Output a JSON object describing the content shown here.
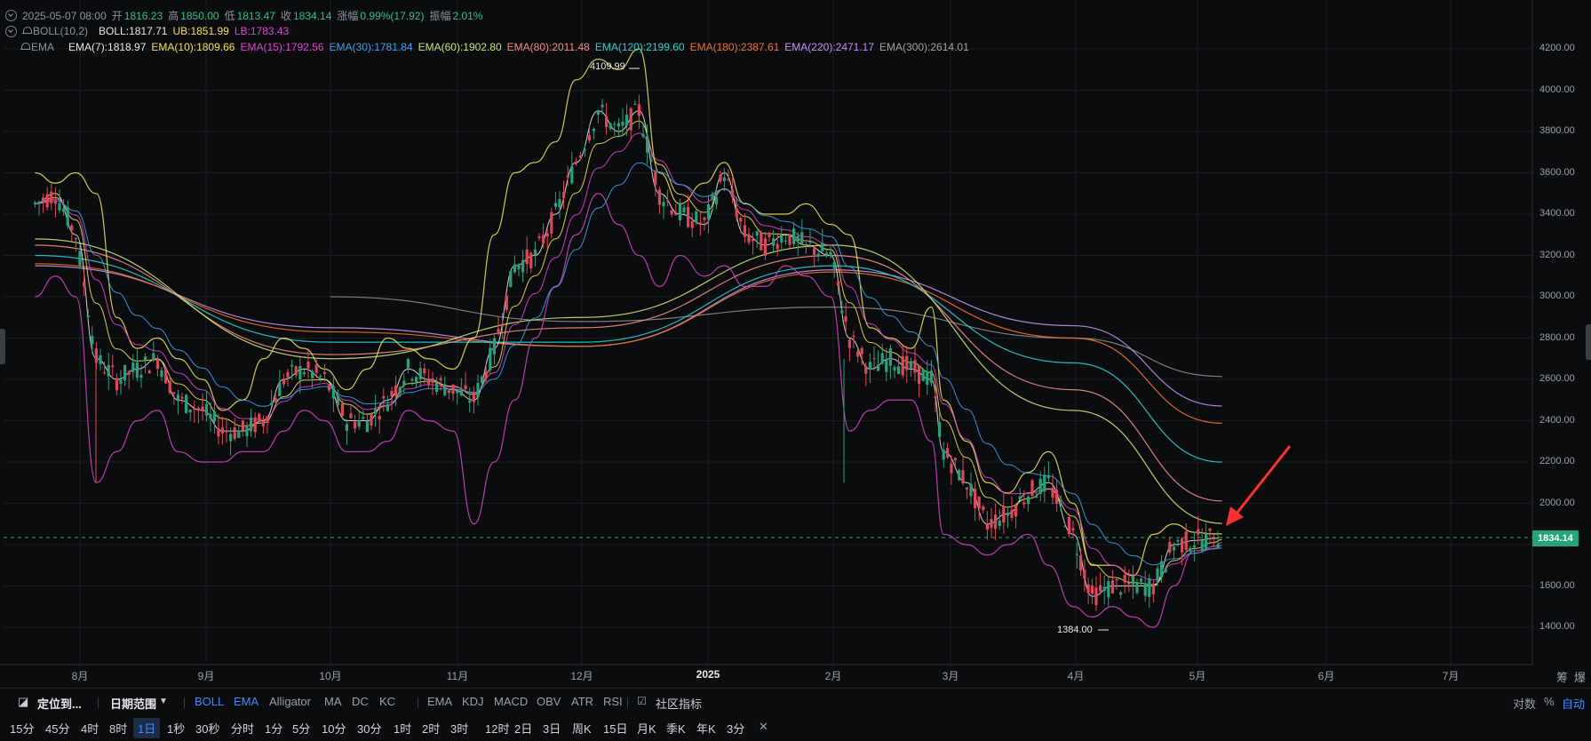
{
  "header": {
    "line1": {
      "date": "2025-05-07 08:00",
      "open_label": "开",
      "open": "1816.23",
      "high_label": "高",
      "high": "1850.00",
      "low_label": "低",
      "low": "1813.47",
      "close_label": "收",
      "close": "1834.14",
      "change_label": "涨幅",
      "change": "0.99%(17.92)",
      "amp_label": "振幅",
      "amp": "2.01%"
    },
    "line2": {
      "indicator": "BOLL(10,2)",
      "boll": "BOLL:1817.71",
      "ub": "UB:1851.99",
      "lb": "LB:1783.43"
    },
    "line3": {
      "indicator": "EMA",
      "emas": [
        {
          "label": "EMA(7):1818.97",
          "color": "#e6e6e6"
        },
        {
          "label": "EMA(10):1809.66",
          "color": "#f0e040"
        },
        {
          "label": "EMA(15):1792.56",
          "color": "#e040d0"
        },
        {
          "label": "EMA(30):1781.84",
          "color": "#3aa0e8"
        },
        {
          "label": "EMA(60):1902.80",
          "color": "#c8e070"
        },
        {
          "label": "EMA(80):2011.48",
          "color": "#f08a8a"
        },
        {
          "label": "EMA(120):2199.60",
          "color": "#20d0d0"
        },
        {
          "label": "EMA(180):2387.61",
          "color": "#f07020"
        },
        {
          "label": "EMA(220):2471.17",
          "color": "#c090f0"
        },
        {
          "label": "EMA(300):2614.01",
          "color": "#a0a0a0"
        }
      ]
    }
  },
  "chart_data": {
    "type": "candlestick",
    "title": "",
    "ylim": [
      1300,
      4300
    ],
    "y_ticks": [
      "4200.00",
      "4000.00",
      "3800.00",
      "3600.00",
      "3400.00",
      "3200.00",
      "3000.00",
      "2800.00",
      "2600.00",
      "2400.00",
      "2200.00",
      "2000.00",
      "1800.00",
      "1600.00",
      "1400.00"
    ],
    "x_ticks": [
      "8月",
      "9月",
      "10月",
      "11月",
      "12月",
      "2025",
      "2月",
      "3月",
      "4月",
      "5月",
      "6月",
      "7月"
    ],
    "last_price": "1834.14",
    "annotations": {
      "high": "4109.99",
      "low": "1384.00"
    },
    "close_series": {
      "x": [
        "07-20",
        "07-25",
        "07-30",
        "08-05",
        "08-10",
        "08-15",
        "08-20",
        "08-25",
        "08-31",
        "09-05",
        "09-10",
        "09-15",
        "09-20",
        "09-25",
        "09-30",
        "10-05",
        "10-10",
        "10-15",
        "10-20",
        "10-25",
        "10-31",
        "11-05",
        "11-10",
        "11-15",
        "11-20",
        "11-25",
        "11-30",
        "12-05",
        "12-10",
        "12-15",
        "12-20",
        "12-25",
        "12-31",
        "01-05",
        "01-10",
        "01-15",
        "01-20",
        "01-25",
        "01-31",
        "02-05",
        "02-10",
        "02-15",
        "02-20",
        "02-25",
        "02-28",
        "03-05",
        "03-10",
        "03-15",
        "03-20",
        "03-25",
        "03-31",
        "04-05",
        "04-10",
        "04-15",
        "04-20",
        "04-25",
        "04-30",
        "05-05",
        "05-07"
      ],
      "values": [
        3450,
        3500,
        3300,
        2700,
        2600,
        2650,
        2700,
        2500,
        2450,
        2350,
        2350,
        2400,
        2600,
        2650,
        2600,
        2400,
        2400,
        2500,
        2650,
        2600,
        2550,
        2500,
        2750,
        3150,
        3200,
        3400,
        3650,
        3900,
        3800,
        3900,
        3500,
        3400,
        3350,
        3600,
        3300,
        3250,
        3300,
        3250,
        3200,
        2800,
        2650,
        2700,
        2650,
        2600,
        2250,
        2100,
        1900,
        1950,
        2050,
        2100,
        1850,
        1550,
        1600,
        1600,
        1600,
        1800,
        1820,
        1830,
        1834.14
      ]
    },
    "ema_series": [
      {
        "name": "EMA(300)",
        "color": "#8a8a8a",
        "x": [
          "10-01",
          "12-01",
          "02-01",
          "03-31",
          "05-07"
        ],
        "values": [
          3000,
          2880,
          2950,
          2800,
          2614.01
        ]
      },
      {
        "name": "EMA(220)",
        "color": "#c090f0",
        "x": [
          "07-20",
          "10-01",
          "12-01",
          "02-01",
          "03-31",
          "05-07"
        ],
        "values": [
          3150,
          2850,
          2760,
          3130,
          2860,
          2471.17
        ]
      },
      {
        "name": "EMA(180)",
        "color": "#f07020",
        "x": [
          "07-20",
          "10-01",
          "12-01",
          "02-01",
          "03-31",
          "05-07"
        ],
        "values": [
          3160,
          2830,
          2760,
          3120,
          2800,
          2387.61
        ]
      },
      {
        "name": "EMA(120)",
        "color": "#20d0d0",
        "x": [
          "07-20",
          "10-01",
          "12-01",
          "02-01",
          "03-31",
          "05-07"
        ],
        "values": [
          3200,
          2780,
          2780,
          3150,
          2680,
          2199.6
        ]
      },
      {
        "name": "EMA(80)",
        "color": "#f08a8a",
        "x": [
          "07-20",
          "10-01",
          "12-01",
          "02-01",
          "03-31",
          "05-07"
        ],
        "values": [
          3250,
          2720,
          2850,
          3200,
          2550,
          2011.48
        ]
      },
      {
        "name": "EMA(60)",
        "color": "#c8e070",
        "x": [
          "07-20",
          "10-01",
          "12-01",
          "02-01",
          "03-31",
          "05-07"
        ],
        "values": [
          3280,
          2700,
          2900,
          3250,
          2450,
          1902.8
        ]
      }
    ],
    "boll_series": {
      "upper": [
        3600,
        3550,
        3600,
        3500,
        2900,
        2750,
        2800,
        2700,
        2600,
        2450,
        2500,
        2700,
        2800,
        2750,
        2650,
        2550,
        2650,
        2800,
        2750,
        2700,
        2650,
        2800,
        3300,
        3600,
        3650,
        3750,
        4050,
        4150,
        4100,
        4200,
        3600,
        3450,
        3550,
        3650,
        3450,
        3400,
        3400,
        3450,
        3350,
        3300,
        2850,
        2800,
        2750,
        2950,
        2500,
        2300,
        2100,
        2050,
        2150,
        2250,
        2000,
        1700,
        1700,
        1650,
        1850,
        1900,
        1860,
        1852,
        1851.99
      ],
      "lower": [
        3000,
        3100,
        3000,
        2100,
        2250,
        2400,
        2450,
        2250,
        2200,
        2200,
        2250,
        2250,
        2350,
        2450,
        2400,
        2250,
        2250,
        2300,
        2450,
        2400,
        2350,
        1900,
        2200,
        2500,
        2800,
        3050,
        3300,
        3500,
        3350,
        3200,
        3050,
        3200,
        3100,
        3150,
        3050,
        3050,
        3150,
        3100,
        3000,
        2350,
        2450,
        2500,
        2500,
        2300,
        1850,
        1800,
        1750,
        1800,
        1850,
        1700,
        1500,
        1450,
        1500,
        1450,
        1400,
        1600,
        1770,
        1780,
        1783.43
      ]
    }
  },
  "toolbar": {
    "locate": "定位到...",
    "date_range": "日期范围",
    "indicators_main": [
      {
        "label": "BOLL",
        "on": true
      },
      {
        "label": "EMA",
        "on": true
      },
      {
        "label": "Alligator",
        "on": false
      },
      {
        "label": "MA",
        "on": false
      },
      {
        "label": "DC",
        "on": false
      },
      {
        "label": "KC",
        "on": false
      }
    ],
    "indicators_sub": [
      "EMA",
      "KDJ",
      "MACD",
      "OBV",
      "ATR",
      "RSI"
    ],
    "community": "社区指标",
    "right": {
      "log": "对数",
      "pct": "%",
      "auto": "自动"
    }
  },
  "periods": {
    "items": [
      "15分",
      "45分",
      "4时",
      "8时",
      "1日",
      "1秒",
      "30秒",
      "分时",
      "1分",
      "5分",
      "10分",
      "30分",
      "1时",
      "2时",
      "3时",
      "12时",
      "2日",
      "3日",
      "周K",
      "15日",
      "月K",
      "季K",
      "年K",
      "3分"
    ],
    "selected": "1日"
  },
  "axis_corner": {
    "a": "筹",
    "b": "爆"
  },
  "colors": {
    "up": "#26a17b",
    "down": "#e0455a",
    "last_price_tag": "#21a67a",
    "arrow": "#ff3030"
  }
}
